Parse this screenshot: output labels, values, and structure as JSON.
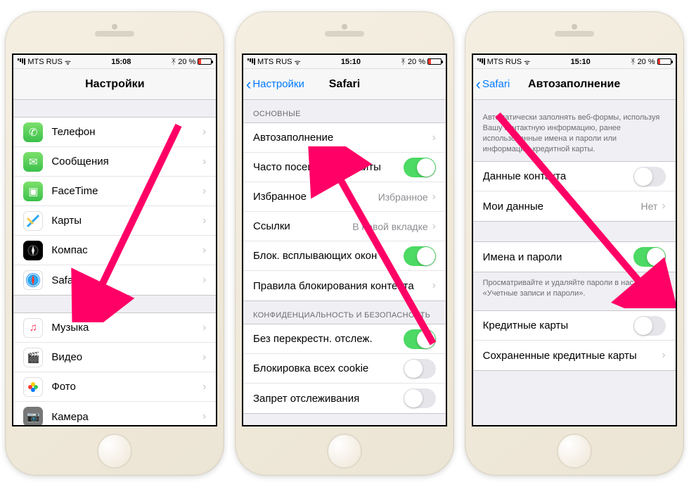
{
  "status": {
    "carrier": "MTS RUS",
    "bluetooth": "✱",
    "battery_text": "20 %"
  },
  "times": {
    "p1": "15:08",
    "p2": "15:10",
    "p3": "15:10"
  },
  "phone1": {
    "title": "Настройки",
    "group1": [
      {
        "label": "Телефон",
        "icon": "phone-handset"
      },
      {
        "label": "Сообщения",
        "icon": "message-bubble"
      },
      {
        "label": "FaceTime",
        "icon": "video-camera"
      },
      {
        "label": "Карты",
        "icon": "maps"
      },
      {
        "label": "Компас",
        "icon": "compass"
      },
      {
        "label": "Safari",
        "icon": "safari"
      }
    ],
    "group2": [
      {
        "label": "Музыка",
        "icon": "music-note"
      },
      {
        "label": "Видео",
        "icon": "clapper"
      },
      {
        "label": "Фото",
        "icon": "photos-flower"
      },
      {
        "label": "Камера",
        "icon": "camera"
      }
    ]
  },
  "phone2": {
    "back": "Настройки",
    "title": "Safari",
    "section1_header": "ОСНОВНЫЕ",
    "rows1": [
      {
        "label": "Автозаполнение",
        "type": "disclosure"
      },
      {
        "label": "Часто посещаемые сайты",
        "type": "toggle",
        "on": true
      },
      {
        "label": "Избранное",
        "type": "detail",
        "detail": "Избранное"
      },
      {
        "label": "Ссылки",
        "type": "detail",
        "detail": "В новой вкладке"
      },
      {
        "label": "Блок. всплывающих окон",
        "type": "toggle",
        "on": true
      },
      {
        "label": "Правила блокирования контента",
        "type": "disclosure"
      }
    ],
    "section2_header": "КОНФИДЕНЦИАЛЬНОСТЬ И БЕЗОПАСНОСТЬ",
    "rows2": [
      {
        "label": "Без перекрестн. отслеж.",
        "type": "toggle",
        "on": true
      },
      {
        "label": "Блокировка всех cookie",
        "type": "toggle",
        "on": false
      },
      {
        "label": "Запрет отслеживания",
        "type": "toggle",
        "on": false
      }
    ]
  },
  "phone3": {
    "back": "Safari",
    "title": "Автозаполнение",
    "intro": "Автоматически заполнять веб-формы, используя Вашу контактную информацию, ранее использованные имена и пароли или информацию кредитной карты.",
    "rows1": [
      {
        "label": "Данные контакта",
        "type": "toggle",
        "on": false
      },
      {
        "label": "Мои данные",
        "type": "detail",
        "detail": "Нет"
      }
    ],
    "rows2": [
      {
        "label": "Имена и пароли",
        "type": "toggle",
        "on": true
      }
    ],
    "footer2": "Просматривайте и удаляйте пароли в настройках «Учетные записи и пароли».",
    "rows3": [
      {
        "label": "Кредитные карты",
        "type": "toggle",
        "on": false
      },
      {
        "label": "Сохраненные кредитные карты",
        "type": "disclosure"
      }
    ]
  }
}
